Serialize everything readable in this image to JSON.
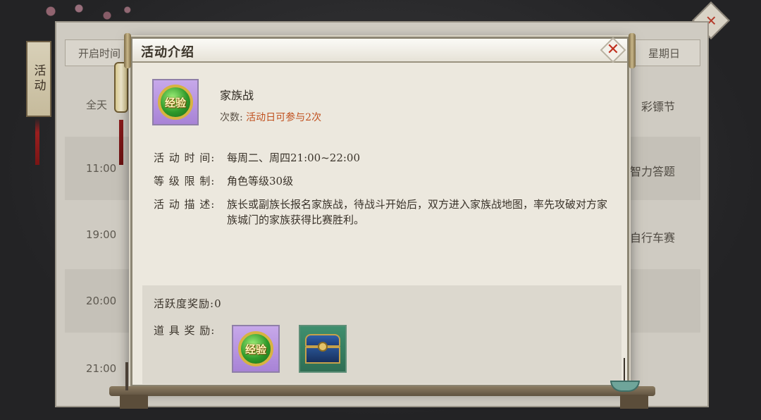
{
  "schedule": {
    "header_left": "开启时间",
    "header_right": "星期日",
    "rows": [
      {
        "time": "全天",
        "right": "彩镖节"
      },
      {
        "time": "11:00",
        "right": "智力答题"
      },
      {
        "time": "19:00",
        "right": "自行车赛"
      },
      {
        "time": "20:00",
        "right": ""
      },
      {
        "time": "21:00",
        "right": ""
      }
    ]
  },
  "side_tab": {
    "label": "活动"
  },
  "dialog": {
    "title": "活动介绍",
    "close_icon": "close-x-icon",
    "activity": {
      "icon": "exp-orb-icon",
      "icon_text": "经验",
      "name": "家族战",
      "count_label": "次数:",
      "count_value": "活动日可参与2次"
    },
    "info": [
      {
        "key": "活 动 时 间:",
        "value": "每周二、周四21:00~22:00"
      },
      {
        "key": "等 级 限 制:",
        "value": "角色等级30级"
      },
      {
        "key": "活 动 描 述:",
        "value": "族长或副族长报名家族战，待战斗开始后，双方进入家族战地图，率先攻破对方家族城门的家族获得比赛胜利。"
      }
    ],
    "rewards": {
      "activity_label": "活跃度奖励:",
      "activity_value": "0",
      "items_label": "道 具 奖 励:",
      "items": [
        {
          "icon": "exp-orb-icon",
          "text": "经验"
        },
        {
          "icon": "treasure-chest-icon"
        }
      ]
    }
  },
  "colors": {
    "dialog_bg": "#ece8de",
    "accent_count": "#c0501e",
    "close_red": "#c0301f"
  }
}
